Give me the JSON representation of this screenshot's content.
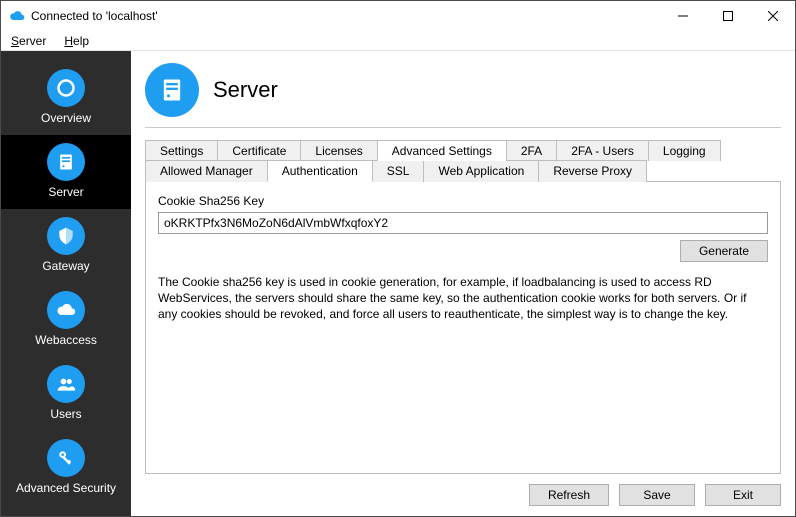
{
  "window": {
    "title": "Connected to 'localhost'"
  },
  "menu": {
    "server": "Server",
    "help": "Help"
  },
  "sidebar": {
    "items": [
      {
        "label": "Overview"
      },
      {
        "label": "Server"
      },
      {
        "label": "Gateway"
      },
      {
        "label": "Webaccess"
      },
      {
        "label": "Users"
      },
      {
        "label": "Advanced Security"
      }
    ]
  },
  "header": {
    "title": "Server"
  },
  "tabs_top": {
    "settings": "Settings",
    "certificate": "Certificate",
    "licenses": "Licenses",
    "advanced": "Advanced Settings",
    "twofa": "2FA",
    "twofa_users": "2FA - Users",
    "logging": "Logging"
  },
  "tabs_sub": {
    "allowed_manager": "Allowed Manager",
    "authentication": "Authentication",
    "ssl": "SSL",
    "web_application": "Web Application",
    "reverse_proxy": "Reverse Proxy"
  },
  "auth_panel": {
    "label": "Cookie Sha256 Key",
    "value": "oKRKTPfx3N6MoZoN6dAlVmbWfxqfoxY2",
    "generate": "Generate",
    "help": "The Cookie sha256 key is used in cookie generation, for example, if loadbalancing is used to access RD WebServices, the servers should share the same key, so the authentication cookie works for both servers. Or if any cookies should be revoked, and force all users to reauthenticate, the simplest way is to change the key."
  },
  "footer": {
    "refresh": "Refresh",
    "save": "Save",
    "exit": "Exit"
  }
}
